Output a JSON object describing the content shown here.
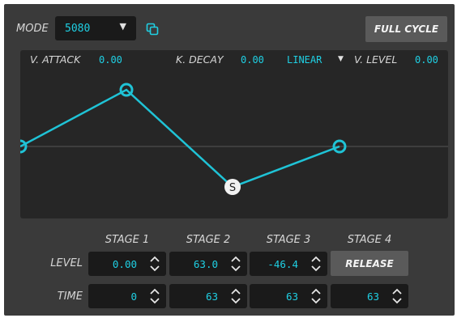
{
  "header": {
    "mode_label": "MODE",
    "mode_value": "5080",
    "copy_icon": "copy-icon",
    "full_cycle_label": "FULL CYCLE"
  },
  "envelope": {
    "attack_label": "V. ATTACK",
    "attack_value": "0.00",
    "decay_label": "K. DECAY",
    "decay_value": "0.00",
    "curve_value": "LINEAR",
    "level_label": "V. LEVEL",
    "level_value": "0.00",
    "sustain_marker": "S"
  },
  "stages": {
    "headers": [
      "STAGE 1",
      "STAGE 2",
      "STAGE 3",
      "STAGE 4"
    ],
    "level_label": "LEVEL",
    "time_label": "TIME",
    "levels": [
      "0.00",
      "63.0",
      "-46.4"
    ],
    "release_label": "RELEASE",
    "times": [
      "0",
      "63",
      "63",
      "63"
    ]
  },
  "colors": {
    "panel": "#3a3a3a",
    "accent": "#1fd0e4",
    "field": "#1a1a1a",
    "graph_bg": "#262626"
  }
}
